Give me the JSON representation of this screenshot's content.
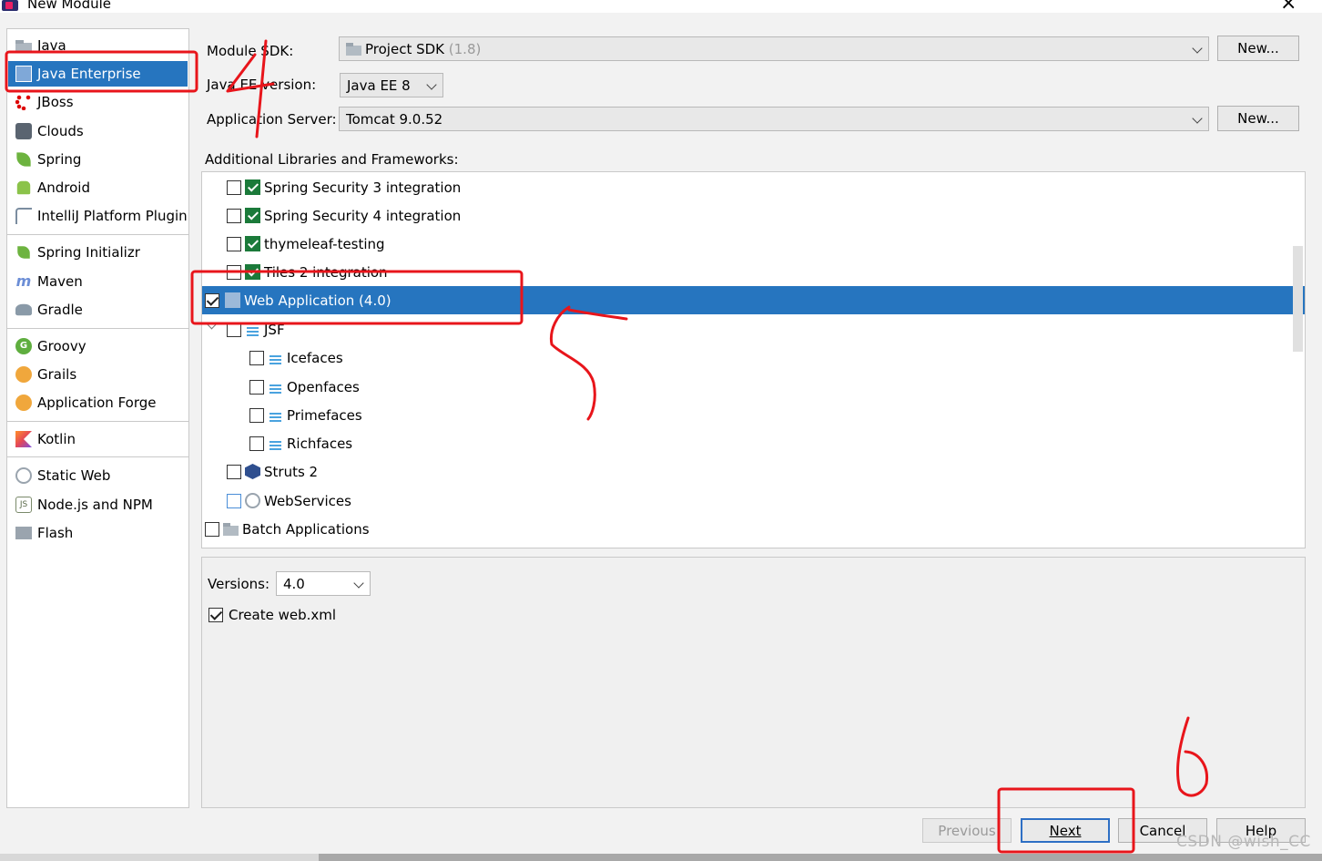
{
  "window": {
    "title": "New Module",
    "close_label": "×"
  },
  "sidebar": {
    "items": [
      {
        "label": "Java",
        "icon": "folder-icon"
      },
      {
        "label": "Java Enterprise",
        "icon": "java-enterprise-icon"
      },
      {
        "label": "JBoss",
        "icon": "jboss-icon"
      },
      {
        "label": "Clouds",
        "icon": "clouds-icon"
      },
      {
        "label": "Spring",
        "icon": "spring-leaf-icon"
      },
      {
        "label": "Android",
        "icon": "android-icon"
      },
      {
        "label": "IntelliJ Platform Plugin",
        "icon": "intellij-plugin-icon"
      },
      {
        "label": "Spring Initializr",
        "icon": "spring-initializr-icon"
      },
      {
        "label": "Maven",
        "icon": "maven-icon"
      },
      {
        "label": "Gradle",
        "icon": "gradle-icon"
      },
      {
        "label": "Groovy",
        "icon": "groovy-icon"
      },
      {
        "label": "Grails",
        "icon": "grails-icon"
      },
      {
        "label": "Application Forge",
        "icon": "application-forge-icon"
      },
      {
        "label": "Kotlin",
        "icon": "kotlin-icon"
      },
      {
        "label": "Static Web",
        "icon": "static-web-icon"
      },
      {
        "label": "Node.js and NPM",
        "icon": "nodejs-icon"
      },
      {
        "label": "Flash",
        "icon": "flash-icon"
      }
    ],
    "selected": "Java Enterprise"
  },
  "form": {
    "module_sdk_label": "Module SDK:",
    "module_sdk_value": "Project SDK",
    "module_sdk_version": "(1.8)",
    "new_sdk_button": "New...",
    "javaee_version_label": "Java EE version:",
    "javaee_version_value": "Java EE 8",
    "app_server_label": "Application Server:",
    "app_server_value": "Tomcat 9.0.52",
    "new_server_button": "New...",
    "libraries_label": "Additional Libraries and Frameworks:"
  },
  "frameworks": [
    {
      "label": "Spring Security 3 integration",
      "checked": false,
      "icon": "spring-security-icon"
    },
    {
      "label": "Spring Security 4 integration",
      "checked": false,
      "icon": "spring-security-icon"
    },
    {
      "label": "thymeleaf-testing",
      "checked": false,
      "icon": "thymeleaf-icon"
    },
    {
      "label": "Tiles 2 integration",
      "checked": false,
      "icon": "tiles-icon"
    },
    {
      "label": "Web Application (4.0)",
      "checked": true,
      "icon": "web-application-icon"
    },
    {
      "label": "JSF",
      "checked": false,
      "icon": "jsf-icon"
    },
    {
      "label": "Icefaces",
      "checked": false,
      "icon": "jsf-icon"
    },
    {
      "label": "Openfaces",
      "checked": false,
      "icon": "jsf-icon"
    },
    {
      "label": "Primefaces",
      "checked": false,
      "icon": "jsf-icon"
    },
    {
      "label": "Richfaces",
      "checked": false,
      "icon": "jsf-icon"
    },
    {
      "label": "Struts 2",
      "checked": false,
      "icon": "struts-icon"
    },
    {
      "label": "WebServices",
      "checked": false,
      "icon": "webservices-icon"
    },
    {
      "label": "Batch Applications",
      "checked": false,
      "icon": "folder-icon"
    }
  ],
  "config": {
    "versions_label": "Versions:",
    "versions_value": "4.0",
    "create_webxml_label": "Create web.xml",
    "create_webxml_checked": true
  },
  "footer": {
    "previous": "Previous",
    "next": "Next",
    "cancel": "Cancel",
    "help": "Help"
  },
  "annotations": {
    "step4": "4",
    "step5": "5",
    "step6": "6",
    "color": "#e8151b"
  },
  "watermark": "CSDN @wish_CC",
  "colors": {
    "selection": "#2675bf",
    "primary_button_border": "#2d6fc4"
  }
}
